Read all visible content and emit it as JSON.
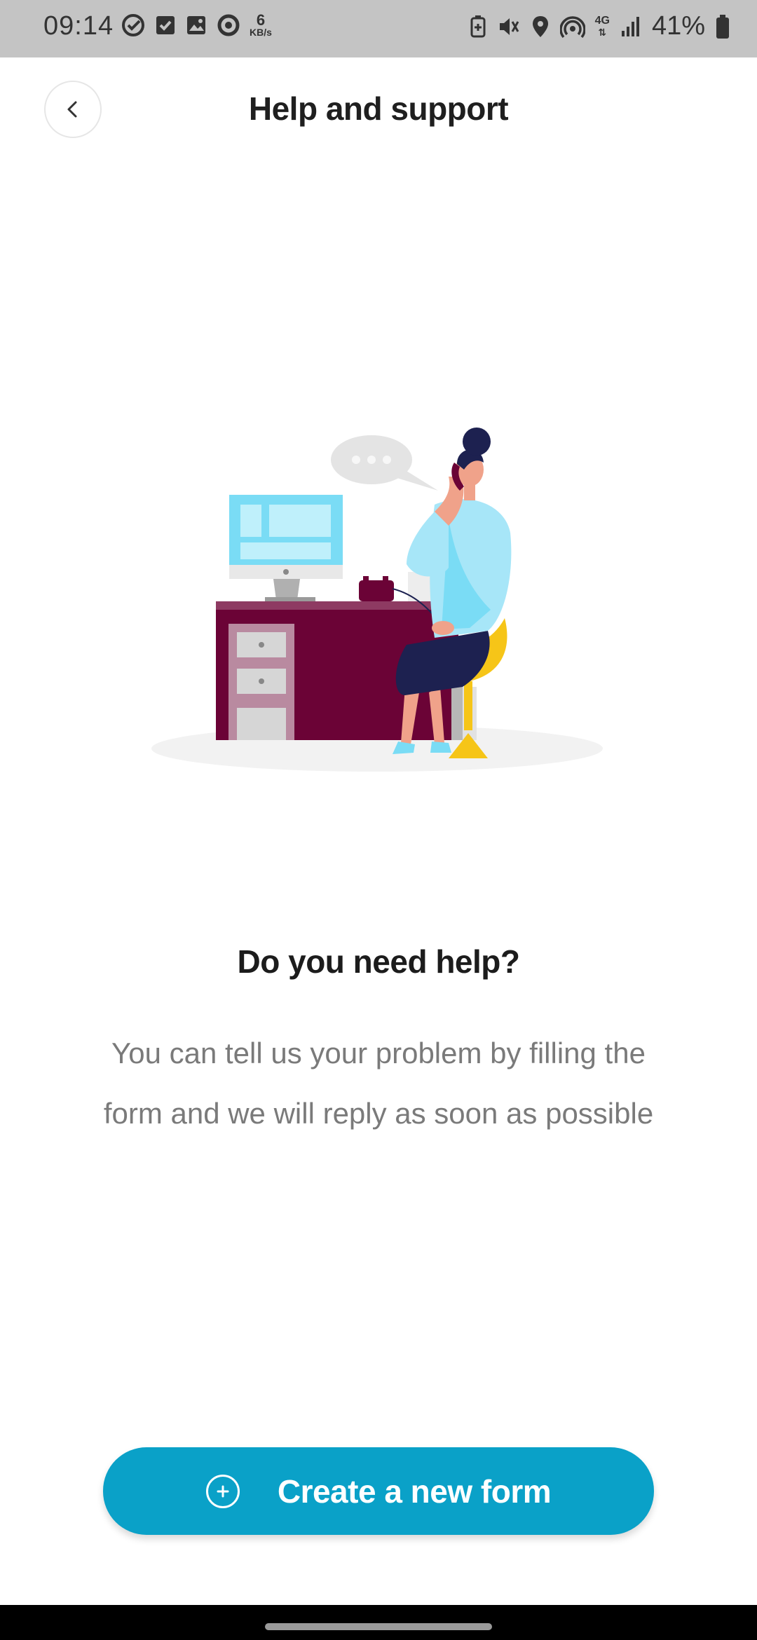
{
  "status_bar": {
    "time": "09:14",
    "net_speed_value": "6",
    "net_speed_unit": "KB/s",
    "network_type": "4G",
    "battery_percent": "41%",
    "icons_left": [
      "task-done-icon",
      "checkbox-icon",
      "gallery-icon",
      "sync-icon"
    ],
    "icons_right": [
      "battery-saver-icon",
      "mute-icon",
      "location-icon",
      "hotspot-icon",
      "network-4g-icon",
      "signal-icon",
      "battery-icon"
    ]
  },
  "header": {
    "title": "Help and support",
    "back_icon": "chevron-left-icon"
  },
  "content": {
    "heading": "Do you need help?",
    "description": "You can tell us your problem by filling the form and we will reply as soon as possible"
  },
  "cta": {
    "label": "Create a new form",
    "icon": "plus-circle-icon",
    "color": "#0aa1c8"
  },
  "colors": {
    "desk": "#6b0336",
    "monitor": "#7adcf5",
    "shirt": "#a7e6f8",
    "skirt": "#1d2150",
    "chair": "#f6c518"
  }
}
